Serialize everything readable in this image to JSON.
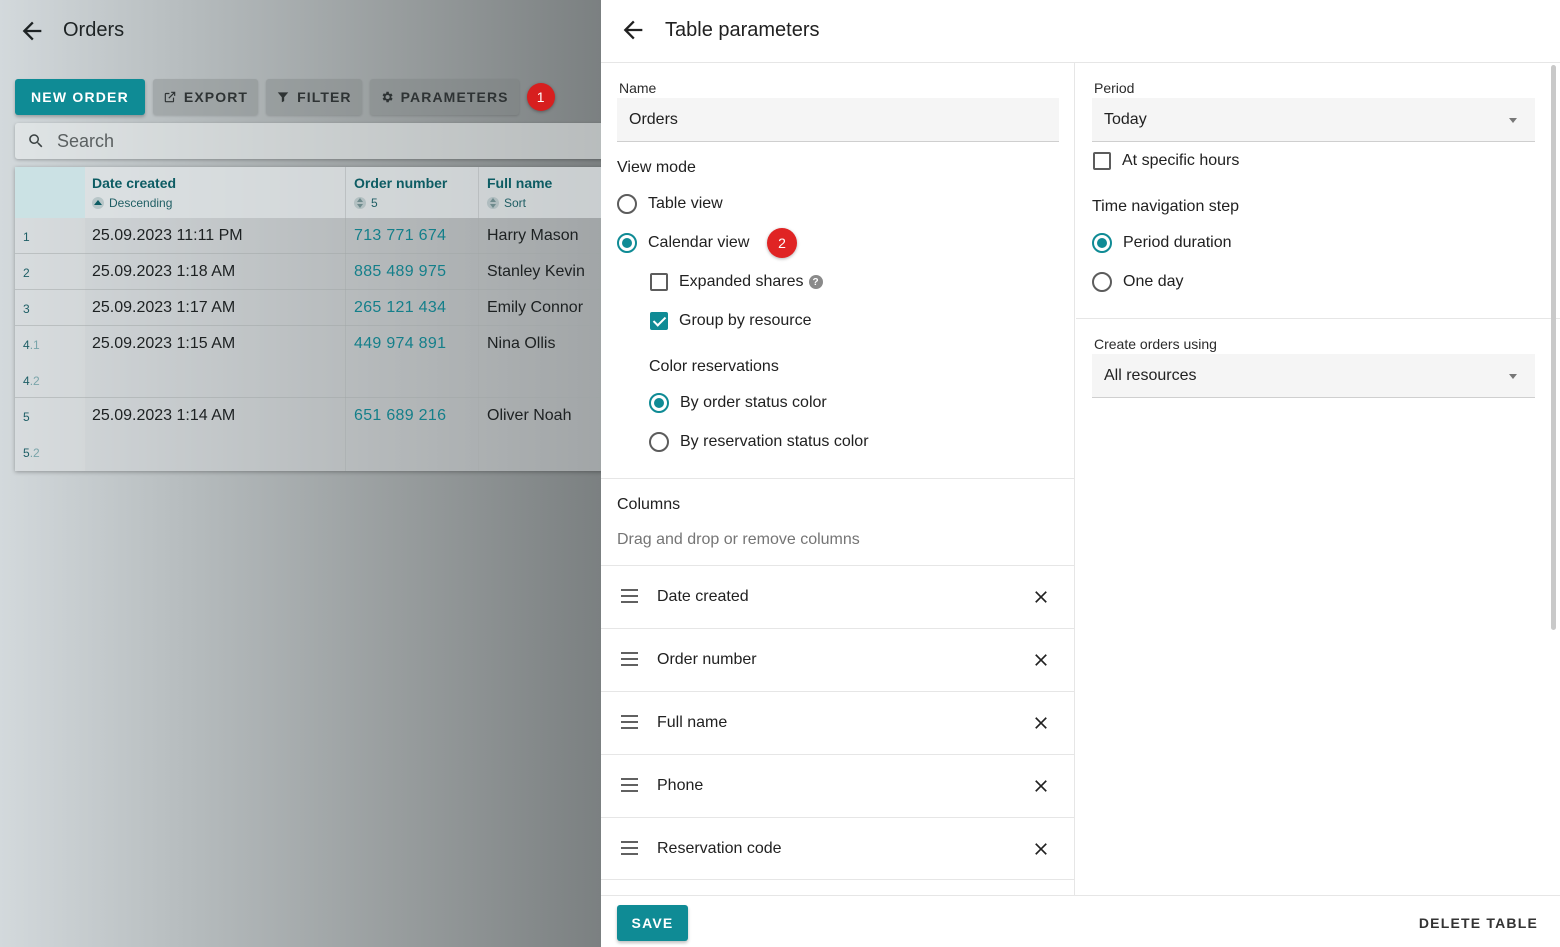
{
  "background_page": {
    "title": "Orders",
    "toolbar": {
      "new_order": "NEW ORDER",
      "export": "EXPORT",
      "filter": "FILTER",
      "parameters": "PARAMETERS",
      "callout": "1"
    },
    "search": {
      "placeholder": "Search"
    },
    "table": {
      "columns": [
        {
          "title": "Date created",
          "sort": "Descending"
        },
        {
          "title": "Order number",
          "sort": "5"
        },
        {
          "title": "Full name",
          "sort": "Sort"
        }
      ],
      "rows": [
        {
          "index": "1",
          "date": "25.09.2023 11:11 PM",
          "number": "713 771 674",
          "name": "Harry Mason"
        },
        {
          "index": "2",
          "date": "25.09.2023 1:18 AM",
          "number": "885 489 975",
          "name": "Stanley Kevin"
        },
        {
          "index": "3",
          "date": "25.09.2023 1:17 AM",
          "number": "265 121 434",
          "name": "Emily Connor"
        },
        {
          "index": "4",
          "sub1": ".1",
          "sub2": ".2",
          "date": "25.09.2023 1:15 AM",
          "number": "449 974 891",
          "name": "Nina Ollis"
        },
        {
          "index": "5",
          "sub2": ".2",
          "date": "25.09.2023 1:14 AM",
          "number": "651 689 216",
          "name": "Oliver Noah"
        }
      ]
    }
  },
  "panel": {
    "title": "Table parameters",
    "name": {
      "label": "Name",
      "value": "Orders"
    },
    "view_mode": {
      "label": "View mode",
      "table_view": "Table view",
      "calendar_view": "Calendar view",
      "callout": "2",
      "expanded_shares": "Expanded shares",
      "group_by_resource": "Group by resource",
      "color_reservations": {
        "label": "Color reservations",
        "by_order_status": "By order status color",
        "by_reservation_status": "By reservation status color"
      }
    },
    "columns": {
      "label": "Columns",
      "hint": "Drag and drop or remove columns",
      "items": [
        "Date created",
        "Order number",
        "Full name",
        "Phone",
        "Reservation code"
      ]
    },
    "period": {
      "label": "Period",
      "value": "Today",
      "at_specific_hours": "At specific hours"
    },
    "time_step": {
      "label": "Time navigation step",
      "period_duration": "Period duration",
      "one_day": "One day"
    },
    "create_orders": {
      "label": "Create orders using",
      "value": "All resources"
    },
    "footer": {
      "save": "SAVE",
      "delete": "DELETE TABLE"
    }
  },
  "colors": {
    "accent": "#0f8b95",
    "callout": "#e02424"
  }
}
